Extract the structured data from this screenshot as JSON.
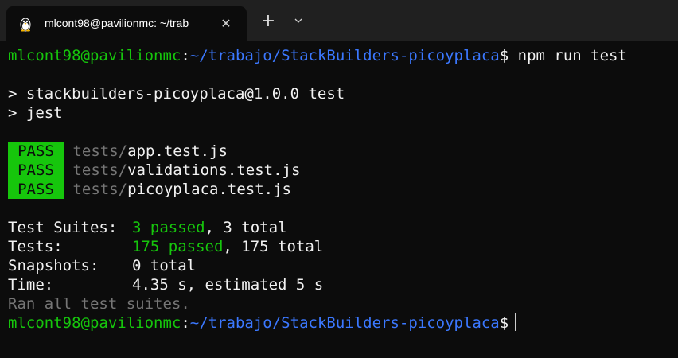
{
  "window": {
    "tab_title": "mlcont98@pavilionmc: ~/trab",
    "tab_icon": "linux-penguin-icon",
    "close_icon": "close-icon",
    "new_tab_icon": "plus-icon",
    "dropdown_icon": "chevron-down-icon"
  },
  "prompt": {
    "user_host": "mlcont98@pavilionmc",
    "sep": ":",
    "path": "~/trabajo/StackBuilders-picoyplaca",
    "symbol": "$",
    "command": " npm run test"
  },
  "npm_output": [
    "> stackbuilders-picoyplaca@1.0.0 test",
    "> jest"
  ],
  "results": [
    {
      "status": "PASS",
      "dir": "tests/",
      "file": "app.test.js"
    },
    {
      "status": "PASS",
      "dir": "tests/",
      "file": "validations.test.js"
    },
    {
      "status": "PASS",
      "dir": "tests/",
      "file": "picoyplaca.test.js"
    }
  ],
  "summary": {
    "suites_label": "Test Suites:",
    "suites_passed": "3 passed",
    "suites_total": ", 3 total",
    "tests_label": "Tests:",
    "tests_passed": "175 passed",
    "tests_total": ", 175 total",
    "snapshots_label": "Snapshots:",
    "snapshots_value": "0 total",
    "time_label": "Time:",
    "time_value": "4.35 s, estimated 5 s",
    "ran_all": "Ran all test suites."
  },
  "colors": {
    "background": "#0c0c0c",
    "green": "#16c60c",
    "blue": "#3b78ff",
    "gray": "#767676",
    "text": "#cccccc"
  }
}
